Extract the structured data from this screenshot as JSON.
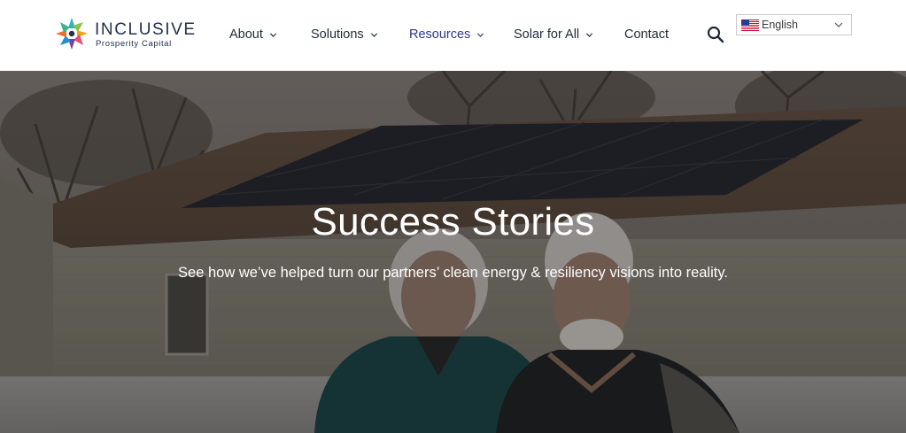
{
  "brand": {
    "name": "INCLUSIVE",
    "subtitle": "Prosperity Capital"
  },
  "nav": {
    "items": [
      {
        "label": "About",
        "has_dropdown": true,
        "active": false
      },
      {
        "label": "Solutions",
        "has_dropdown": true,
        "active": false
      },
      {
        "label": "Resources",
        "has_dropdown": true,
        "active": true
      },
      {
        "label": "Solar for All",
        "has_dropdown": true,
        "active": false
      },
      {
        "label": "Contact",
        "has_dropdown": false,
        "active": false
      }
    ],
    "search_icon": "search-icon"
  },
  "language": {
    "selected": "English",
    "flag": "us-flag-icon"
  },
  "hero": {
    "title": "Success Stories",
    "subtitle": "See how we’ve helped turn our partners’ clean energy & resiliency visions into reality."
  },
  "colors": {
    "nav_active": "#2b3a86",
    "nav_text": "#1d2a3a",
    "hero_text": "#ffffff"
  }
}
